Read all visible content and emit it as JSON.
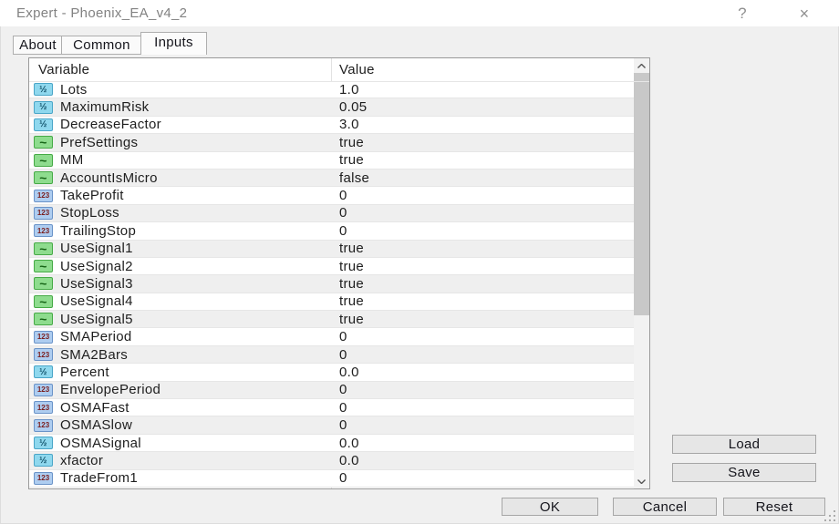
{
  "window": {
    "title": "Expert - Phoenix_EA_v4_2",
    "help_icon": "?",
    "close_icon": "×"
  },
  "tabs": [
    {
      "label": "About",
      "active": false
    },
    {
      "label": "Common",
      "active": false
    },
    {
      "label": "Inputs",
      "active": true
    }
  ],
  "table": {
    "columns": [
      "Variable",
      "Value"
    ],
    "icon_glyphs": {
      "double": "½",
      "int": "123",
      "bool": "~"
    },
    "rows": [
      {
        "type": "double",
        "name": "Lots",
        "value": "1.0"
      },
      {
        "type": "double",
        "name": "MaximumRisk",
        "value": "0.05"
      },
      {
        "type": "double",
        "name": "DecreaseFactor",
        "value": "3.0"
      },
      {
        "type": "bool",
        "name": "PrefSettings",
        "value": "true"
      },
      {
        "type": "bool",
        "name": "MM",
        "value": "true"
      },
      {
        "type": "bool",
        "name": "AccountIsMicro",
        "value": "false"
      },
      {
        "type": "int",
        "name": "TakeProfit",
        "value": "0"
      },
      {
        "type": "int",
        "name": "StopLoss",
        "value": "0"
      },
      {
        "type": "int",
        "name": "TrailingStop",
        "value": "0"
      },
      {
        "type": "bool",
        "name": "UseSignal1",
        "value": "true"
      },
      {
        "type": "bool",
        "name": "UseSignal2",
        "value": "true"
      },
      {
        "type": "bool",
        "name": "UseSignal3",
        "value": "true"
      },
      {
        "type": "bool",
        "name": "UseSignal4",
        "value": "true"
      },
      {
        "type": "bool",
        "name": "UseSignal5",
        "value": "true"
      },
      {
        "type": "int",
        "name": "SMAPeriod",
        "value": "0"
      },
      {
        "type": "int",
        "name": "SMA2Bars",
        "value": "0"
      },
      {
        "type": "double",
        "name": "Percent",
        "value": "0.0"
      },
      {
        "type": "int",
        "name": "EnvelopePeriod",
        "value": "0"
      },
      {
        "type": "int",
        "name": "OSMAFast",
        "value": "0"
      },
      {
        "type": "int",
        "name": "OSMASlow",
        "value": "0"
      },
      {
        "type": "double",
        "name": "OSMASignal",
        "value": "0.0"
      },
      {
        "type": "double",
        "name": "xfactor",
        "value": "0.0"
      },
      {
        "type": "int",
        "name": "TradeFrom1",
        "value": "0"
      }
    ]
  },
  "buttons": {
    "load": "Load",
    "save": "Save",
    "ok": "OK",
    "cancel": "Cancel",
    "reset": "Reset"
  },
  "colors": {
    "dialog_bg": "#f0f0f0",
    "titlebar_bg": "#ffffff",
    "row_stripe": "#efefef",
    "double_icon": "#8fd8ee",
    "int_icon": "#aecdf0",
    "bool_icon": "#8edc8e",
    "scroll_thumb": "#c8c8c8"
  }
}
